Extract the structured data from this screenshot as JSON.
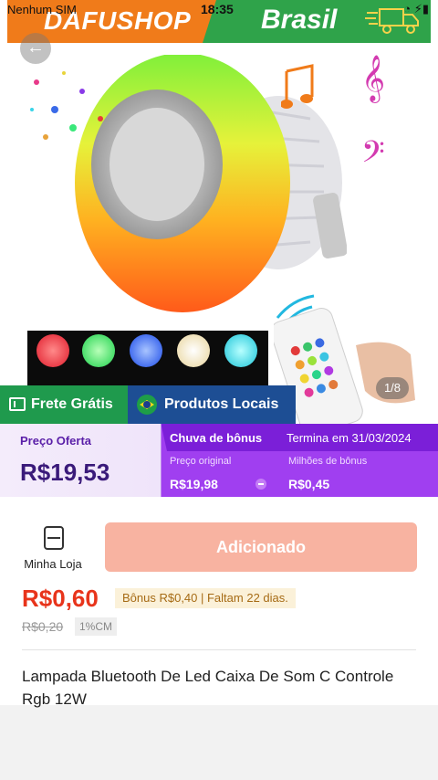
{
  "status_bar": {
    "carrier": "Nenhum SIM",
    "time": "18:35"
  },
  "banner": {
    "brand": "DAFUSHOP",
    "country": "Brasil"
  },
  "gallery": {
    "counter": "1/8"
  },
  "tags": {
    "shipping": "Frete Grátis",
    "local": "Produtos Locais"
  },
  "offer": {
    "label": "Preço Oferta",
    "price": "R$19,53"
  },
  "bonus_rain": {
    "title": "Chuva de bônus",
    "ends": "Termina em 31/03/2024",
    "original_label": "Preço original",
    "original_value": "R$19,98",
    "millions_label": "Milhões de bônus",
    "millions_value": "R$0,45"
  },
  "purchase": {
    "store_label": "Minha Loja",
    "add_button": "Adicionado",
    "price": "R$0,60",
    "bonus_note": "Bônus R$0,40  |  Faltam 22 dias.",
    "old_price": "R$0,20",
    "cm_badge": "1%CM"
  },
  "product": {
    "title": "Lampada Bluetooth De Led Caixa De Som C Controle Rgb 12W"
  },
  "colors": {
    "brand_orange": "#f07b1a",
    "brand_green": "#2fa34a",
    "price_red": "#e8341b",
    "bonus_purple": "#a03ff0",
    "button_salmon": "#f8b3a1"
  }
}
